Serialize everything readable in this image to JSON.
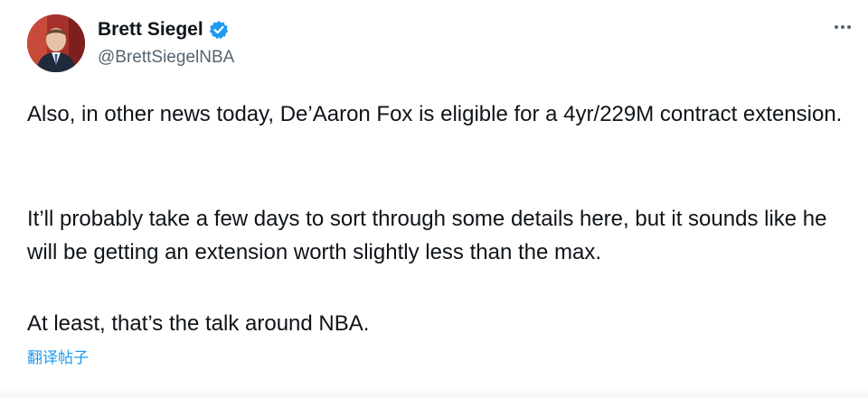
{
  "tweet": {
    "author": {
      "display_name": "Brett Siegel",
      "handle": "@BrettSiegelNBA",
      "verified": true
    },
    "more_icon": "more-horizontal-icon",
    "body": {
      "paragraph_1": "Also, in other news today, De’Aaron Fox is eligible for a 4yr/229M contract extension.",
      "paragraph_2": "It’ll probably take a few days to sort through some details here, but it sounds like he will be getting an extension worth slightly less than the max.",
      "paragraph_3": "At least, that’s the talk around NBA."
    },
    "translate_label": "翻译帖子"
  },
  "colors": {
    "text": "#0f1419",
    "secondary": "#536471",
    "accent": "#1d9bf0"
  }
}
